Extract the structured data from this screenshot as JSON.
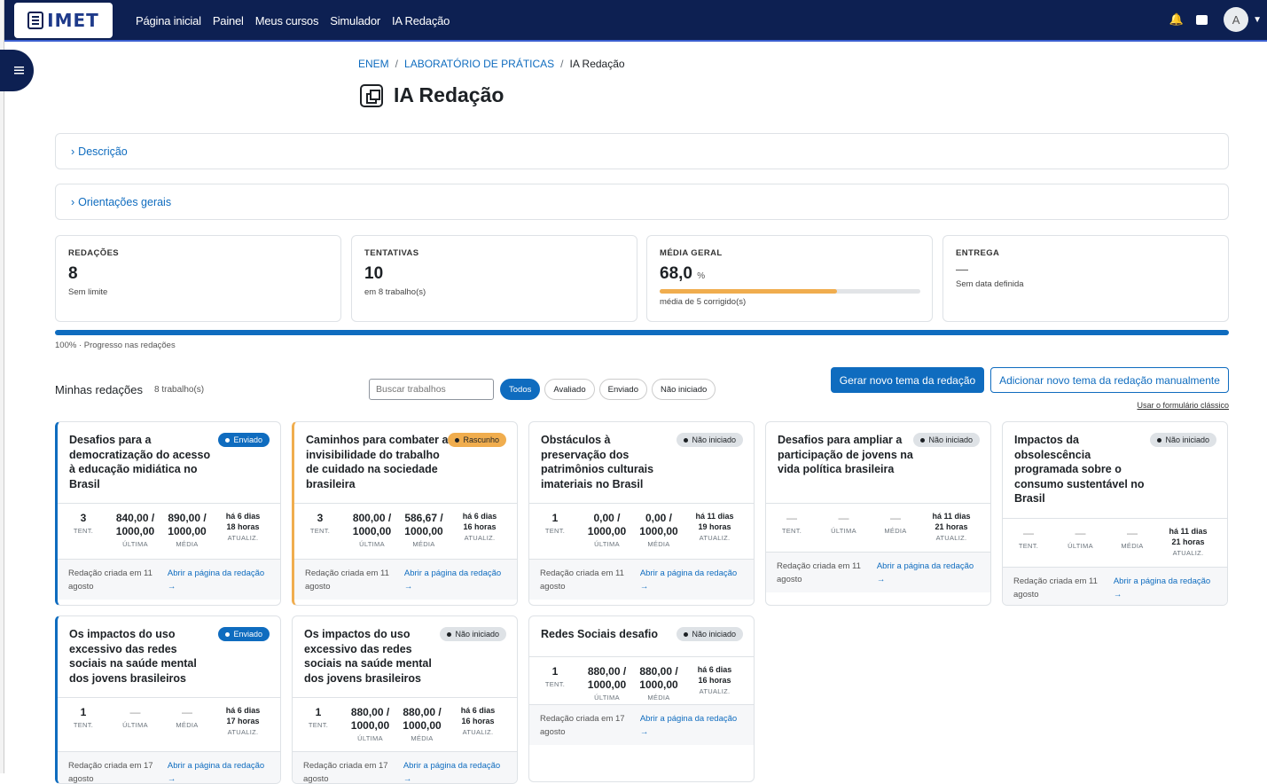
{
  "nav": {
    "logo_text": "IMET",
    "links": [
      "Página inicial",
      "Painel",
      "Meus cursos",
      "Simulador",
      "IA Redação"
    ],
    "avatar": "A"
  },
  "breadcrumb": [
    "ENEM",
    "LABORATÓRIO DE PRÁTICAS",
    "IA Redação"
  ],
  "page_title": "IA Redação",
  "sections": {
    "descricao": "Descrição",
    "orientacoes": "Orientações gerais"
  },
  "stats": [
    {
      "label": "REDAÇÕES",
      "value": "8",
      "sub": "Sem limite"
    },
    {
      "label": "TENTATIVAS",
      "value": "10",
      "sub": "em 8 trabalho(s)"
    },
    {
      "label": "MÉDIA GERAL",
      "value": "68,0",
      "unit": "%",
      "sub": "média de 5 corrigido(s)",
      "meter": 0.68
    },
    {
      "label": "ENTREGA",
      "value": "—",
      "sub": "Sem data definida"
    }
  ],
  "progress": {
    "value": 1.0,
    "label": "100% · Progresso nas redações"
  },
  "list": {
    "title": "Minhas redações",
    "count": "8 trabalho(s)",
    "search_placeholder": "Buscar trabalhos",
    "filters": [
      "Todos",
      "Avaliado",
      "Enviado",
      "Não iniciado"
    ],
    "btn_generate": "Gerar novo tema da redação",
    "btn_add": "Adicionar novo tema da redação manualmente",
    "classic_link": "Usar o formulário clássico"
  },
  "labels": {
    "tent": "TENT.",
    "ultima": "ÚLTIMA",
    "media": "MÉDIA",
    "atualiz": "ATUALIZ.",
    "open": "Abrir a página da redação →"
  },
  "colors": {
    "navy": "#0d2052",
    "primary": "#0f6cbf",
    "warning": "#f0ad4e"
  },
  "cards": [
    {
      "title": "Desafios para a democratização do acesso à educação midiática no Brasil",
      "status": "Enviado",
      "tent": "3",
      "ultima": [
        "840,00 /",
        "1000,00"
      ],
      "media": [
        "890,00 /",
        "1000,00"
      ],
      "atualiz": [
        "há 6 dias",
        "18 horas"
      ],
      "created": "Redação criada em 11 agosto"
    },
    {
      "title": "Caminhos para combater a invisibilidade do trabalho de cuidado na sociedade brasileira",
      "status": "Rascunho",
      "tent": "3",
      "ultima": [
        "800,00 /",
        "1000,00"
      ],
      "media": [
        "586,67 /",
        "1000,00"
      ],
      "atualiz": [
        "há 6 dias",
        "16 horas"
      ],
      "created": "Redação criada em 11 agosto"
    },
    {
      "title": "Obstáculos à preservação dos patrimônios culturais imateriais no Brasil",
      "status": "Não iniciado",
      "tent": "1",
      "ultima": [
        "0,00 /",
        "1000,00"
      ],
      "media": [
        "0,00 /",
        "1000,00"
      ],
      "atualiz": [
        "há 11 dias",
        "19 horas"
      ],
      "created": "Redação criada em 11 agosto"
    },
    {
      "title": "Desafios para ampliar a participação de jovens na vida política brasileira",
      "status": "Não iniciado",
      "tent": "—",
      "ultima": [
        "—"
      ],
      "media": [
        "—"
      ],
      "atualiz": [
        "há 11 dias",
        "21 horas"
      ],
      "created": "Redação criada em 11 agosto"
    },
    {
      "title": "Impactos da obsolescência programada sobre o consumo sustentável no Brasil",
      "status": "Não iniciado",
      "tent": "—",
      "ultima": [
        "—"
      ],
      "media": [
        "—"
      ],
      "atualiz": [
        "há 11 dias",
        "21 horas"
      ],
      "created": "Redação criada em 11 agosto"
    },
    {
      "title": "Os impactos do uso excessivo das redes sociais na saúde mental dos jovens brasileiros",
      "status": "Enviado",
      "tent": "1",
      "ultima": [
        "—"
      ],
      "media": [
        "—"
      ],
      "atualiz": [
        "há 6 dias",
        "17 horas"
      ],
      "created": "Redação criada em 17 agosto"
    },
    {
      "title": "Os impactos do uso excessivo das redes sociais na saúde mental dos jovens brasileiros",
      "status": "Não iniciado",
      "tent": "1",
      "ultima": [
        "880,00 /",
        "1000,00"
      ],
      "media": [
        "880,00 /",
        "1000,00"
      ],
      "atualiz": [
        "há 6 dias",
        "16 horas"
      ],
      "created": "Redação criada em 17 agosto"
    },
    {
      "title": "Redes Sociais desafio",
      "status": "Não iniciado",
      "tent": "1",
      "ultima": [
        "880,00 /",
        "1000,00"
      ],
      "media": [
        "880,00 /",
        "1000,00"
      ],
      "atualiz": [
        "há 6 dias",
        "16 horas"
      ],
      "created": "Redação criada em 17 agosto"
    }
  ]
}
